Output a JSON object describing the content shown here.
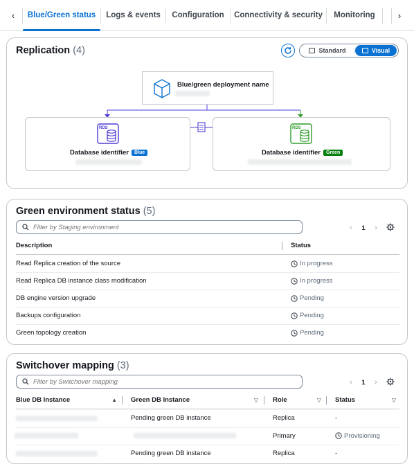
{
  "tabs": {
    "items": [
      {
        "label": "Blue/Green status",
        "active": true
      },
      {
        "label": "Logs & events"
      },
      {
        "label": "Configuration"
      },
      {
        "label": "Connectivity & security"
      },
      {
        "label": "Monitoring"
      }
    ]
  },
  "replication": {
    "title": "Replication",
    "count": "(4)",
    "view_toggle": {
      "standard_label": "Standard",
      "visual_label": "Visual",
      "selected": "Visual"
    },
    "deployment_label": "Blue/green deployment name",
    "blue_db": {
      "label": "Database identifier",
      "badge": "Blue",
      "badge_color": "#0972d3"
    },
    "green_db": {
      "label": "Database identifier",
      "badge": "Green",
      "badge_color": "#037f0c"
    },
    "rds_icon_text": "RDS",
    "colors": {
      "blue_icon": "#4b3cd6",
      "green_icon": "#2f9e2a",
      "arrow": "#4b3cd6",
      "green_arrow": "#2f9e2a"
    }
  },
  "green_env": {
    "title": "Green environment status",
    "count": "(5)",
    "filter_placeholder": "Filter by Staging environment",
    "page": "1",
    "columns": {
      "description": "Description",
      "status": "Status"
    },
    "rows": [
      {
        "description": "Read Replica creation of the source",
        "status": "In progress"
      },
      {
        "description": "Read Replica DB instance class modification",
        "status": "In progress"
      },
      {
        "description": "DB engine version upgrade",
        "status": "Pending"
      },
      {
        "description": "Backups configuration",
        "status": "Pending"
      },
      {
        "description": "Green topology creation",
        "status": "Pending"
      }
    ]
  },
  "switchover": {
    "title": "Switchover mapping",
    "count": "(3)",
    "filter_placeholder": "Filter by Switchover mapping",
    "page": "1",
    "columns": {
      "blue": "Blue DB Instance",
      "green": "Green DB Instance",
      "role": "Role",
      "status": "Status"
    },
    "rows": [
      {
        "green": "Pending green DB instance",
        "role": "Replica",
        "status": "-"
      },
      {
        "green": "",
        "role": "Primary",
        "status": "Provisioning"
      },
      {
        "green": "Pending green DB instance",
        "role": "Replica",
        "status": "-"
      }
    ]
  },
  "icons": {
    "prev": "chevron-left-icon",
    "next": "chevron-right-icon",
    "refresh": "refresh-icon",
    "search": "search-icon",
    "settings": "gear-icon",
    "status": "clock-status-icon",
    "deployment": "cube-icon",
    "database": "rds-database-icon",
    "document": "document-icon"
  }
}
